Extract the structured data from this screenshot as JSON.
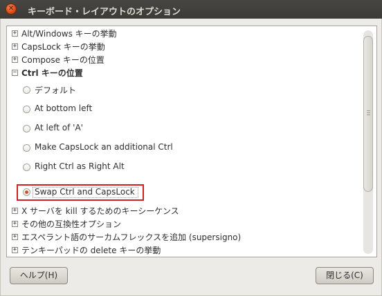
{
  "window": {
    "title": "キーボード・レイアウトのオプション"
  },
  "tree": {
    "groups_top": [
      {
        "expander": "+",
        "label": "Alt/Windows キーの挙動"
      },
      {
        "expander": "+",
        "label": "CapsLock キーの挙動"
      },
      {
        "expander": "+",
        "label": "Compose キーの位置"
      }
    ],
    "expanded_group": {
      "expander": "−",
      "label": "Ctrl キーの位置"
    },
    "options": [
      {
        "label": "デフォルト",
        "checked": false
      },
      {
        "label": "At bottom left",
        "checked": false
      },
      {
        "label": "At left of 'A'",
        "checked": false
      },
      {
        "label": "Make CapsLock an additional Ctrl",
        "checked": false
      },
      {
        "label": "Right Ctrl as Right Alt",
        "checked": false
      },
      {
        "label": "Swap Ctrl and CapsLock",
        "checked": true
      }
    ],
    "groups_bottom": [
      {
        "expander": "+",
        "label": "X サーバを kill するためのキーシーケンス"
      },
      {
        "expander": "+",
        "label": "その他の互換性オプション"
      },
      {
        "expander": "+",
        "label": "エスペラント語のサーカムフレックスを追加 (supersigno)"
      },
      {
        "expander": "+",
        "label": "テンキーパッドの delete キーの挙動"
      }
    ]
  },
  "buttons": {
    "help": "ヘルプ(H)",
    "close": "閉じる(C)"
  },
  "colors": {
    "titlebar": "#3c3b37",
    "accent": "#d35123",
    "highlight": "#d02020"
  }
}
